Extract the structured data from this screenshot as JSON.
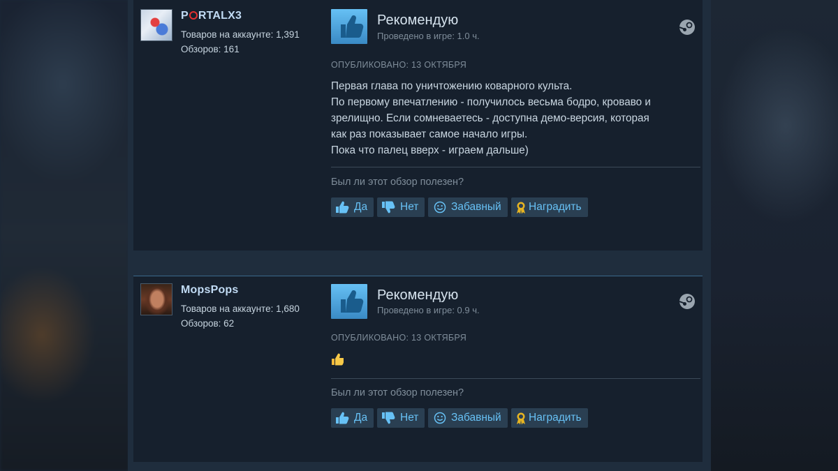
{
  "reviews": [
    {
      "username_prefix": "P",
      "username_suffix": "RTALX3",
      "products_label": "Товаров на аккаунте: 1,391",
      "reviews_label": "Обзоров: 161",
      "recommendation": "Рекомендую",
      "hours": "Проведено в игре: 1.0 ч.",
      "posted": "ОПУБЛИКОВАНО: 13 ОКТЯБРЯ",
      "content_lines": [
        "Первая глава по уничтожению коварного культа.",
        "По первому впечатлению - получилось весьма бодро, кроваво и",
        "зрелищно. Если сомневаетесь - доступна демо-версия, которая",
        "как раз показывает самое начало игры.",
        "Пока что палец вверх - играем дальше)"
      ],
      "helpful_question": "Был ли этот обзор полезен?",
      "buttons": {
        "yes": "Да",
        "no": "Нет",
        "funny": "Забавный",
        "award": "Наградить"
      }
    },
    {
      "username": "MopsPops",
      "products_label": "Товаров на аккаунте: 1,680",
      "reviews_label": "Обзоров: 62",
      "recommendation": "Рекомендую",
      "hours": "Проведено в игре: 0.9 ч.",
      "posted": "ОПУБЛИКОВАНО: 13 ОКТЯБРЯ",
      "content_emoji": "thumbs-up-emoji",
      "helpful_question": "Был ли этот обзор полезен?",
      "buttons": {
        "yes": "Да",
        "no": "Нет",
        "funny": "Забавный",
        "award": "Наградить"
      }
    }
  ],
  "icons": {
    "recommend": "thumbs-up-icon",
    "platform": "steam-icon",
    "yes": "thumbs-up-icon",
    "no": "thumbs-down-icon",
    "funny": "smiley-icon",
    "award": "award-ribbon-icon"
  },
  "colors": {
    "page_bg": "#1b2838",
    "card_bg": "#16202d",
    "accent": "#67c1f5",
    "thumb_box": "#66c0f4",
    "username": "#c1dbf4",
    "muted": "#7f8d9a",
    "button_bg": "#2a3f52",
    "award_gold": "#e6b422"
  }
}
